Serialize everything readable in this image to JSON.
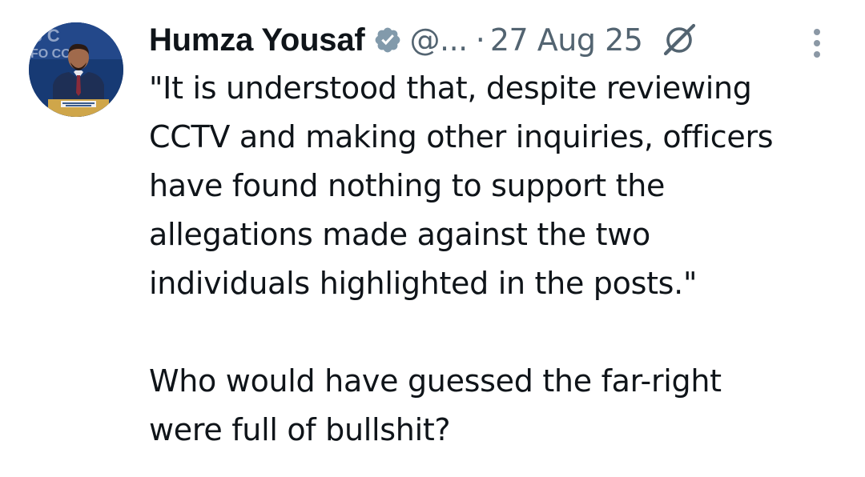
{
  "post": {
    "author": {
      "display_name": "Humza Yousaf",
      "handle": "@...",
      "verified_icon": "verified-badge-icon"
    },
    "separator": "·",
    "date": "27 Aug 25",
    "grok_icon": "grok-icon",
    "more_icon": "more-vertical-icon",
    "text_paragraph_1": "\"It is understood that, despite reviewing\nCCTV and making other inquiries, officers\nhave found nothing to support the\nallegations made against the two\nindividuals highlighted in the posts.\"",
    "text_paragraph_2": "Who would have guessed the far-right\nwere full of bullshit?"
  },
  "colors": {
    "text_primary": "#0f1419",
    "text_secondary": "#536471",
    "verified_badge": "#829aab"
  }
}
